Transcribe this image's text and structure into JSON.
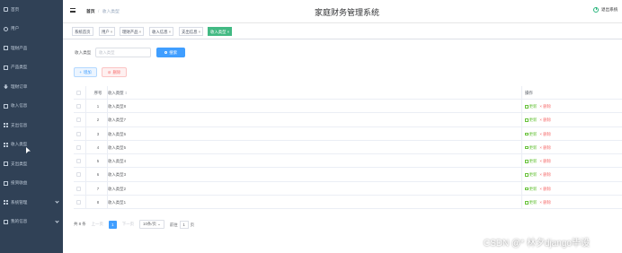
{
  "sidebar": {
    "items": [
      {
        "label": "首页",
        "icon": "home-icon",
        "has_children": false
      },
      {
        "label": "用户",
        "icon": "user-icon",
        "has_children": false
      },
      {
        "label": "理财产品",
        "icon": "document-icon",
        "has_children": false
      },
      {
        "label": "产品类型",
        "icon": "document-icon",
        "has_children": false
      },
      {
        "label": "理财订单",
        "icon": "download-icon",
        "has_children": false
      },
      {
        "label": "收入信息",
        "icon": "document-icon",
        "has_children": false
      },
      {
        "label": "支出信息",
        "icon": "grid-icon",
        "has_children": false
      },
      {
        "label": "收入类型",
        "icon": "grid-icon",
        "has_children": false
      },
      {
        "label": "支出类型",
        "icon": "document-icon",
        "has_children": false
      },
      {
        "label": "投资收益",
        "icon": "document-icon",
        "has_children": false
      },
      {
        "label": "系统管理",
        "icon": "grid-icon",
        "has_children": true
      },
      {
        "label": "我的信息",
        "icon": "document-icon",
        "has_children": true
      }
    ]
  },
  "header": {
    "breadcrumb_home": "首页",
    "breadcrumb_sep": "/",
    "breadcrumb_current": "收入类型",
    "title": "家庭财务管理系统",
    "logout_label": "退出系统"
  },
  "tags": [
    {
      "label": "系统首页",
      "closable": false,
      "active": false
    },
    {
      "label": "用户",
      "closable": true,
      "active": false
    },
    {
      "label": "理财产品",
      "closable": true,
      "active": false
    },
    {
      "label": "收入信息",
      "closable": true,
      "active": false
    },
    {
      "label": "支出信息",
      "closable": true,
      "active": false
    },
    {
      "label": "收入类型",
      "closable": true,
      "active": true
    }
  ],
  "search": {
    "label": "收入类型",
    "placeholder": "收入类型",
    "button_label": "搜索"
  },
  "actions": {
    "add_label": "增加",
    "delete_label": "删除"
  },
  "table": {
    "headers": {
      "index": "序号",
      "name": "收入类型",
      "operation": "操作"
    },
    "rows": [
      {
        "index": "1",
        "name": "收入类型8"
      },
      {
        "index": "2",
        "name": "收入类型7"
      },
      {
        "index": "3",
        "name": "收入类型6"
      },
      {
        "index": "4",
        "name": "收入类型5"
      },
      {
        "index": "5",
        "name": "收入类型4"
      },
      {
        "index": "6",
        "name": "收入类型3"
      },
      {
        "index": "7",
        "name": "收入类型2"
      },
      {
        "index": "8",
        "name": "收入类型1"
      }
    ],
    "edit_label": "更新",
    "delete_label": "删除"
  },
  "pagination": {
    "total": "共 8 条",
    "prev": "上一页",
    "current_page": "1",
    "next": "下一页",
    "page_size": "10条/页",
    "goto_prefix": "前往",
    "goto_value": "1",
    "goto_suffix": "页"
  },
  "watermark": "CSDN @*  林夕django毕设",
  "colors": {
    "sidebar_bg": "#304156",
    "accent": "#409eff",
    "active_tag": "#42b983",
    "edit": "#67c23a",
    "danger": "#f56c6c"
  }
}
